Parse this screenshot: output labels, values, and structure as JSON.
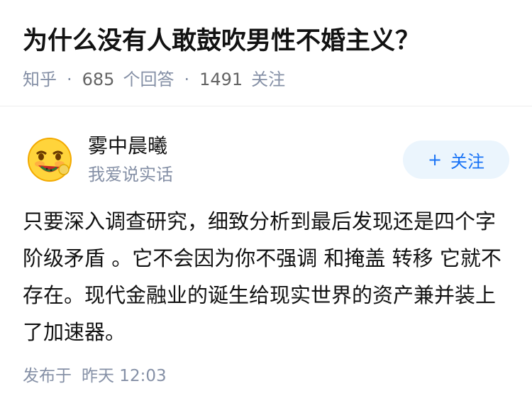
{
  "question": {
    "title": "为什么没有人敢鼓吹男性不婚主义？",
    "source": "知乎",
    "answer_count": "685",
    "answer_label": "个回答",
    "follower_count": "1491",
    "follower_label": "关注"
  },
  "author": {
    "name": "雾中晨曦",
    "bio": "我爱说实话",
    "avatar_icon": "emoji-avatar-icon",
    "follow_label": "关注",
    "follow_icon": "plus-icon"
  },
  "answer": {
    "content": "只要深入调查研究，细致分析到最后发现还是四个字 阶级矛盾 。它不会因为你不强调 和掩盖 转移 它就不存在。现代金融业的诞生给现实世界的资产兼并装上了加速器。",
    "published_label": "发布于",
    "published_time": "昨天 12:03"
  },
  "colors": {
    "primary": "#1772f6",
    "follow_bg": "#ebf5fd",
    "meta": "#8590a6",
    "text": "#121212"
  }
}
